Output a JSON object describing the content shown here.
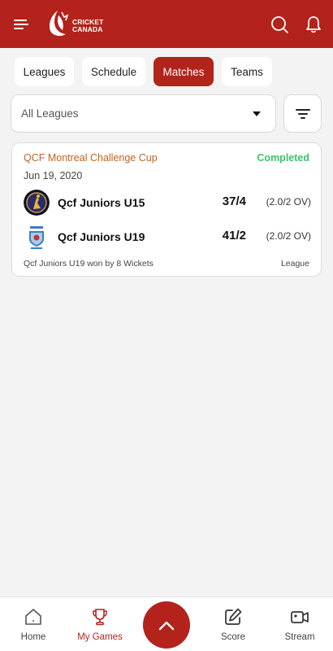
{
  "header": {
    "brand_line1": "CRICKET",
    "brand_line2": "CANADA",
    "brand_color": "#b3231b"
  },
  "tabs": [
    {
      "label": "Leagues",
      "active": false
    },
    {
      "label": "Schedule",
      "active": false
    },
    {
      "label": "Matches",
      "active": true
    },
    {
      "label": "Teams",
      "active": false
    }
  ],
  "filter": {
    "selected": "All Leagues"
  },
  "match": {
    "league": "QCF Montreal Challenge Cup",
    "status": "Completed",
    "date": "Jun 19, 2020",
    "teams": [
      {
        "name": "Qcf Juniors U15",
        "score": "37/4",
        "overs": "(2.0/2 OV)"
      },
      {
        "name": "Qcf Juniors U19",
        "score": "41/2",
        "overs": "(2.0/2 OV)"
      }
    ],
    "result": "Qcf Juniors U19 won by 8 Wickets",
    "type": "League",
    "status_color": "#3cc46a",
    "league_color": "#c0641f"
  },
  "bottom_nav": [
    {
      "label": "Home",
      "icon": "home-icon",
      "active": false
    },
    {
      "label": "My Games",
      "icon": "trophy-icon",
      "active": true
    },
    {
      "label": "Score",
      "icon": "edit-icon",
      "active": false
    },
    {
      "label": "Stream",
      "icon": "video-icon",
      "active": false
    }
  ],
  "fab_icon": "chevron-up-icon"
}
